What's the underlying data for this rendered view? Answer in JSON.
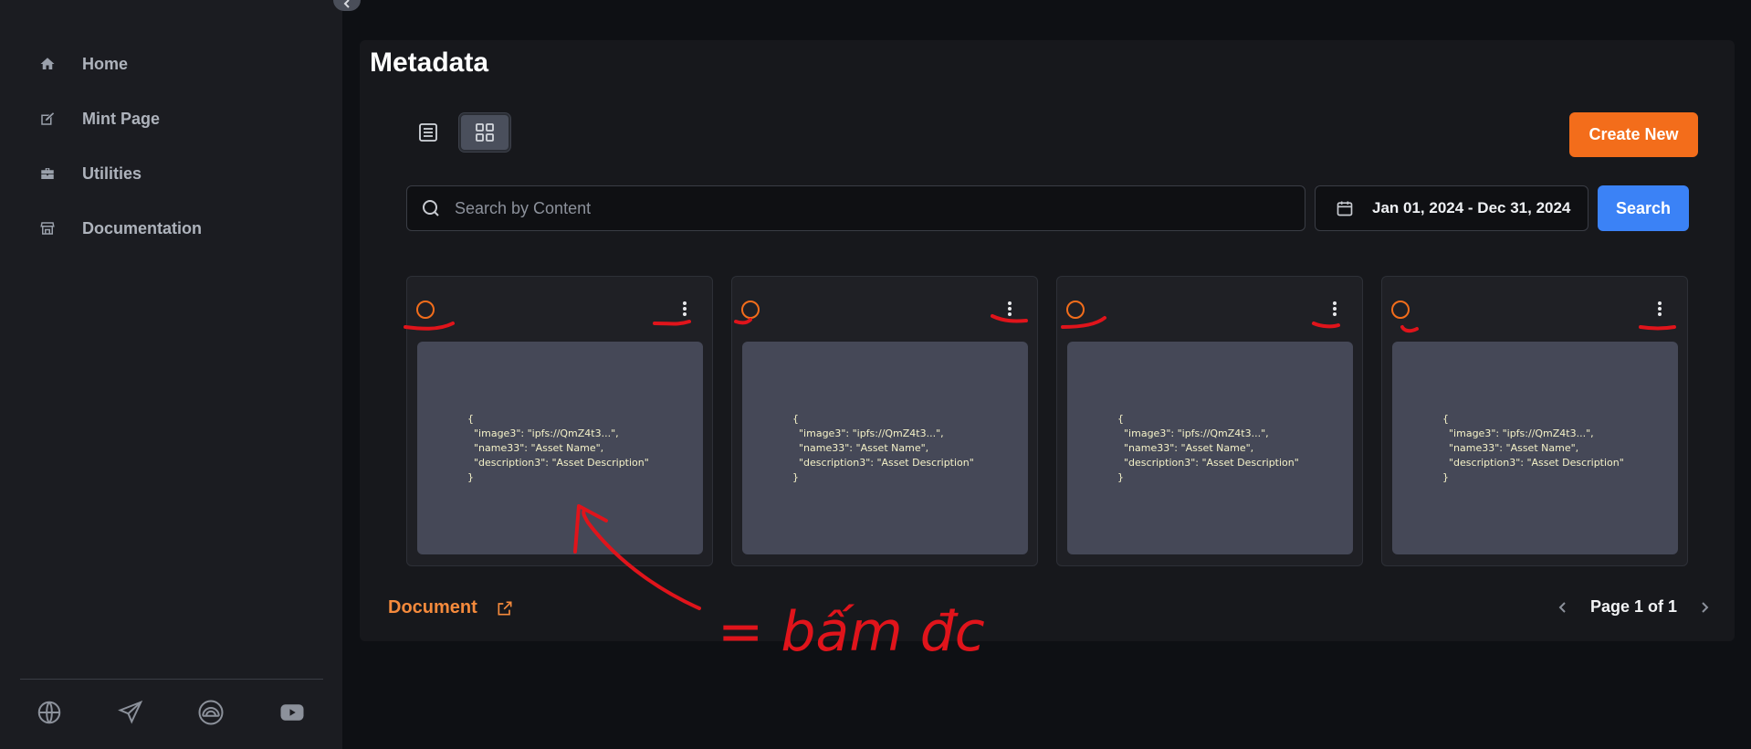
{
  "sidebar": {
    "items": [
      {
        "label": "Home",
        "icon": "home-icon"
      },
      {
        "label": "Mint Page",
        "icon": "mint-icon"
      },
      {
        "label": "Utilities",
        "icon": "toolbox-icon"
      },
      {
        "label": "Documentation",
        "icon": "store-icon"
      }
    ],
    "social_icons": [
      "globe-icon",
      "send-icon",
      "rainbow-icon",
      "youtube-icon"
    ]
  },
  "main": {
    "title": "Metadata",
    "create_label": "Create New",
    "search": {
      "placeholder": "Search by Content",
      "value": ""
    },
    "date_range": "Jan 01, 2024 - Dec 31, 2024",
    "search_label": "Search",
    "cards": [
      {
        "content": "{\n  \"image3\": \"ipfs://QmZ4t3...\",\n  \"name33\": \"Asset Name\",\n  \"description3\": \"Asset Description\"\n}"
      },
      {
        "content": "{\n  \"image3\": \"ipfs://QmZ4t3...\",\n  \"name33\": \"Asset Name\",\n  \"description3\": \"Asset Description\"\n}"
      },
      {
        "content": "{\n  \"image3\": \"ipfs://QmZ4t3...\",\n  \"name33\": \"Asset Name\",\n  \"description3\": \"Asset Description\"\n}"
      },
      {
        "content": "{\n  \"image3\": \"ipfs://QmZ4t3...\",\n  \"name33\": \"Asset Name\",\n  \"description3\": \"Asset Description\"\n}"
      }
    ],
    "document_label": "Document",
    "pagination": "Page 1 of 1"
  },
  "annotation": {
    "note": "= bấm đc",
    "color": "#e0141b"
  },
  "colors": {
    "accent_orange": "#f36d1b",
    "primary_blue": "#3b82f6",
    "background": "#0e1014",
    "sidebar": "#1b1c21"
  }
}
